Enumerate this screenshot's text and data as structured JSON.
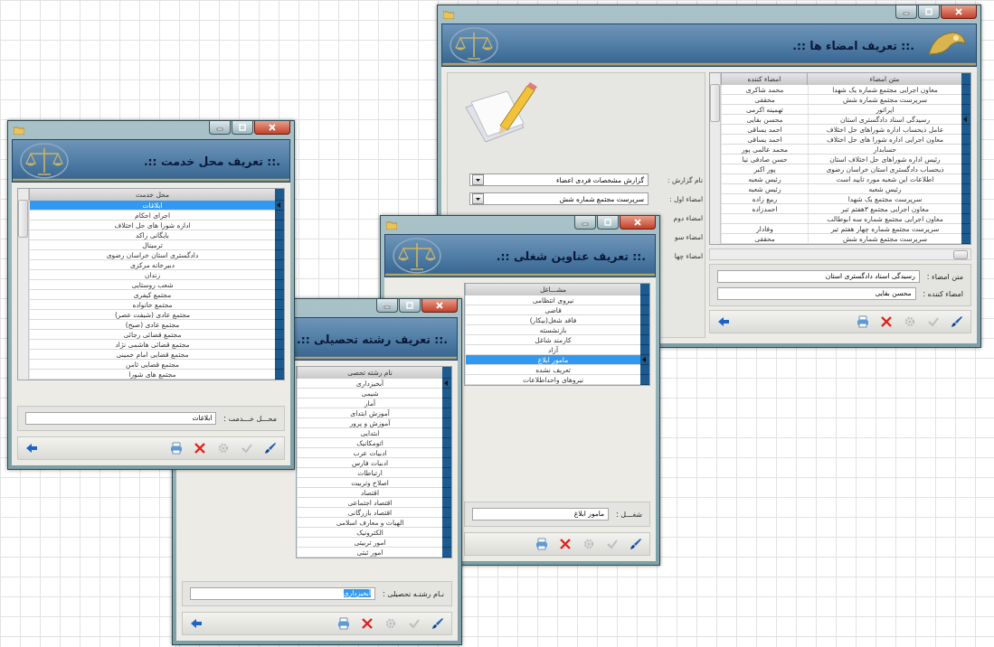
{
  "windows": [
    {
      "kind": "signatures",
      "title": ".:: تعریف امضاء ها ::.",
      "report_fields": [
        {
          "label": "نام گزارش :",
          "value": "گزارش مشخصات فردی اعضاء"
        },
        {
          "label": "امضاء اول :",
          "value": "سرپرست مجتمع شماره  شش"
        },
        {
          "label": "امضاء دوم"
        },
        {
          "label": "امضاء سو"
        },
        {
          "label": "امضاء چها"
        }
      ],
      "table": {
        "focused": false,
        "columns": [
          "متن امضاء",
          "امضاء کننده"
        ],
        "rows": [
          {
            "cells": [
              "معاون اجرایی مجتمع  شماره یک شهدا",
              "محمد شاکری"
            ],
            "selected": false
          },
          {
            "cells": [
              "سرپرست مجتمع شماره  شش",
              "محققی"
            ],
            "selected": false
          },
          {
            "cells": [
              "اپراتور",
              "تهمینه اکرمی"
            ],
            "selected": false
          },
          {
            "cells": [
              "رسیدگی اسناد دادگستری استان",
              "محسن بقایی"
            ],
            "selected": true
          },
          {
            "cells": [
              "عامل ذیحساب اداره شوراهای حل اختلاف",
              "احمد یساقی"
            ],
            "selected": false
          },
          {
            "cells": [
              "معاون اجرایی اداره شورا های حل اختلاف",
              "احمد  یساقی"
            ],
            "selected": false
          },
          {
            "cells": [
              "حسابدار",
              "محمد عالمی پور"
            ],
            "selected": false
          },
          {
            "cells": [
              "رئیس اداره شوراهای حل اختلاف استان",
              "حسن صادقی نیا"
            ],
            "selected": false
          },
          {
            "cells": [
              "ذیحساب دادگستری استان خراسان رضوی",
              "پور اکبر"
            ],
            "selected": false
          },
          {
            "cells": [
              "اطلاعات این شعبه مورد تایید است",
              "رئیس شعبه"
            ],
            "selected": false
          },
          {
            "cells": [
              "رئیس شعبه",
              "رئیس  شعبه"
            ],
            "selected": false
          },
          {
            "cells": [
              "سرپرست مجتمع یک شهدا",
              "ربیع زاده"
            ],
            "selected": false
          },
          {
            "cells": [
              "معاون اجرایی مجتمع ۳هفتم تیر",
              "احمدزاده"
            ],
            "selected": false
          },
          {
            "cells": [
              "معاون اجرایی مجتمع شماره سه ابوطالب"
            ],
            "selected": false
          },
          {
            "cells": [
              "سرپرست مجتمع شماره چهار هفتم تیر",
              "وفادار"
            ],
            "selected": false
          },
          {
            "cells": [
              "سرپرست مجتمع شماره شش",
              "محققی"
            ],
            "selected": false
          }
        ]
      },
      "fields": [
        {
          "label": "متن امضاء :",
          "value": "رسیدگی اسناد دادگستری استان"
        },
        {
          "label": "امضاء کننده :",
          "value": "محسن بقایی"
        }
      ],
      "tools": [
        {
          "kind": "back",
          "disabled": false
        },
        {
          "kind": "print",
          "disabled": false
        },
        {
          "kind": "delete",
          "disabled": false
        },
        {
          "kind": "gear",
          "disabled": true
        },
        {
          "kind": "check",
          "disabled": true
        },
        {
          "kind": "edit",
          "disabled": false
        }
      ]
    },
    {
      "kind": "list",
      "title": ".:: تعریف عناوین شغلی ::.",
      "table": {
        "focused": true,
        "columns": [
          "مشـــاغل"
        ],
        "rows": [
          {
            "cells": [
              "نیروی انتظامی"
            ],
            "selected": false
          },
          {
            "cells": [
              "قاضی"
            ],
            "selected": false
          },
          {
            "cells": [
              "فاقد شغل(بیکار)"
            ],
            "selected": false
          },
          {
            "cells": [
              "بازنشسته"
            ],
            "selected": false
          },
          {
            "cells": [
              "کارمند شاغل"
            ],
            "selected": false
          },
          {
            "cells": [
              "آزاد"
            ],
            "selected": false
          },
          {
            "cells": [
              "مامور ابلاغ"
            ],
            "selected": true
          },
          {
            "cells": [
              "تعریف نشده"
            ],
            "selected": false
          },
          {
            "cells": [
              "نیروهای واحداطلاعات"
            ],
            "selected": false
          }
        ]
      },
      "fields": [
        {
          "label": "شغـــل :",
          "value": "مامور ابلاغ",
          "value_selected": false
        }
      ],
      "tools": [
        {
          "kind": "print",
          "disabled": false
        },
        {
          "kind": "delete",
          "disabled": false
        },
        {
          "kind": "gear",
          "disabled": true
        },
        {
          "kind": "check",
          "disabled": true
        },
        {
          "kind": "edit",
          "disabled": false
        }
      ]
    },
    {
      "kind": "list",
      "title": ".:: تعریف رشته تحصیلی ::.",
      "table": {
        "focused": false,
        "columns": [
          "نام رشته تحصی"
        ],
        "rows": [
          {
            "cells": [
              "آبخیزداری"
            ],
            "selected": true
          },
          {
            "cells": [
              "شیمی"
            ],
            "selected": false
          },
          {
            "cells": [
              "آمار"
            ],
            "selected": false
          },
          {
            "cells": [
              "آموزش ابتدای"
            ],
            "selected": false
          },
          {
            "cells": [
              "آموزش و پرور"
            ],
            "selected": false
          },
          {
            "cells": [
              "ابتدایی"
            ],
            "selected": false
          },
          {
            "cells": [
              "اتومکانیک"
            ],
            "selected": false
          },
          {
            "cells": [
              "ادبیات عرب"
            ],
            "selected": false
          },
          {
            "cells": [
              "ادبیات فارس"
            ],
            "selected": false
          },
          {
            "cells": [
              "ارتباطات"
            ],
            "selected": false
          },
          {
            "cells": [
              "اصلاح وتربیت"
            ],
            "selected": false
          },
          {
            "cells": [
              "اقتصاد"
            ],
            "selected": false
          },
          {
            "cells": [
              "اقتصاد اجتماعی"
            ],
            "selected": false
          },
          {
            "cells": [
              "اقتصاد بازرگانی"
            ],
            "selected": false
          },
          {
            "cells": [
              "الهیات و معارف اسلامی"
            ],
            "selected": false
          },
          {
            "cells": [
              "الکترونیک"
            ],
            "selected": false
          },
          {
            "cells": [
              "امور تربیتی"
            ],
            "selected": false
          },
          {
            "cells": [
              "امور ثبتی"
            ],
            "selected": false
          }
        ]
      },
      "fields": [
        {
          "label": "نـام رشتـه تحصیلی :",
          "value": "آبخیزداری",
          "value_selected": true
        }
      ],
      "tools": [
        {
          "kind": "back",
          "disabled": false
        },
        {
          "kind": "print",
          "disabled": false
        },
        {
          "kind": "delete",
          "disabled": false
        },
        {
          "kind": "gear",
          "disabled": true
        },
        {
          "kind": "check",
          "disabled": true
        },
        {
          "kind": "edit",
          "disabled": false
        }
      ]
    },
    {
      "kind": "list",
      "title": ".:: تعریف محل خدمت ::.",
      "table": {
        "focused": true,
        "columns": [
          "محل خدمت"
        ],
        "rows": [
          {
            "cells": [
              "ابلاغات"
            ],
            "selected": true
          },
          {
            "cells": [
              "اجرای احکام"
            ],
            "selected": false
          },
          {
            "cells": [
              "اداره شورا های حل اختلاف"
            ],
            "selected": false
          },
          {
            "cells": [
              "بایگانی راکد"
            ],
            "selected": false
          },
          {
            "cells": [
              "ترمینال"
            ],
            "selected": false
          },
          {
            "cells": [
              "دادگستری استان خراسان رضوی"
            ],
            "selected": false
          },
          {
            "cells": [
              "دبیرخانه مرکزی"
            ],
            "selected": false
          },
          {
            "cells": [
              "زندان"
            ],
            "selected": false
          },
          {
            "cells": [
              "شعب روستایی"
            ],
            "selected": false
          },
          {
            "cells": [
              "مجتمع  کیفری"
            ],
            "selected": false
          },
          {
            "cells": [
              "مجتمع خانواده"
            ],
            "selected": false
          },
          {
            "cells": [
              "مجتمع عادی (شیفت عصر)"
            ],
            "selected": false
          },
          {
            "cells": [
              "مجتمع عادی (صبح)"
            ],
            "selected": false
          },
          {
            "cells": [
              "مجتمع قضائی رجائی"
            ],
            "selected": false
          },
          {
            "cells": [
              "مجتمع قضائی هاشمی نژاد"
            ],
            "selected": false
          },
          {
            "cells": [
              "مجتمع قضایی امام خمینی"
            ],
            "selected": false
          },
          {
            "cells": [
              "مجتمع قضایی ثامن"
            ],
            "selected": false
          },
          {
            "cells": [
              "مجتمع های شورا"
            ],
            "selected": false
          }
        ]
      },
      "fields": [
        {
          "label": "محـــل خـــدمت :",
          "value": "ابلاغات",
          "value_selected": false
        }
      ],
      "tools": [
        {
          "kind": "back",
          "disabled": false
        },
        {
          "kind": "print",
          "disabled": false
        },
        {
          "kind": "delete",
          "disabled": false
        },
        {
          "kind": "gear",
          "disabled": true
        },
        {
          "kind": "check",
          "disabled": true
        },
        {
          "kind": "edit",
          "disabled": false
        }
      ]
    }
  ]
}
